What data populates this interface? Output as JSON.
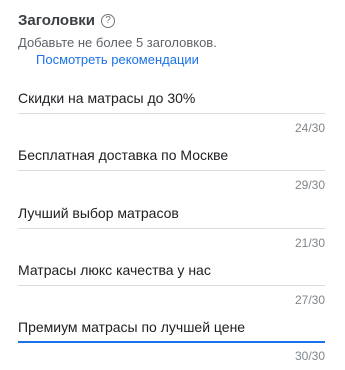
{
  "section": {
    "title": "Заголовки",
    "help_icon": "help-circle-icon",
    "subtitle": "Добавьте не более 5 заголовков.",
    "link": "Посмотреть рекомендации"
  },
  "headlines": [
    {
      "value": "Скидки на матрасы до 30%",
      "counter": "24/30"
    },
    {
      "value": "Бесплатная доставка по Москве",
      "counter": "29/30"
    },
    {
      "value": "Лучший выбор матрасов",
      "counter": "21/30"
    },
    {
      "value": "Матрасы люкс качества у нас",
      "counter": "27/30"
    },
    {
      "value": "Премиум матрасы по лучшей цене",
      "counter": "30/30"
    }
  ],
  "colors": {
    "accent": "#1a73e8",
    "divider": "#dadce0",
    "muted": "#80868b"
  }
}
